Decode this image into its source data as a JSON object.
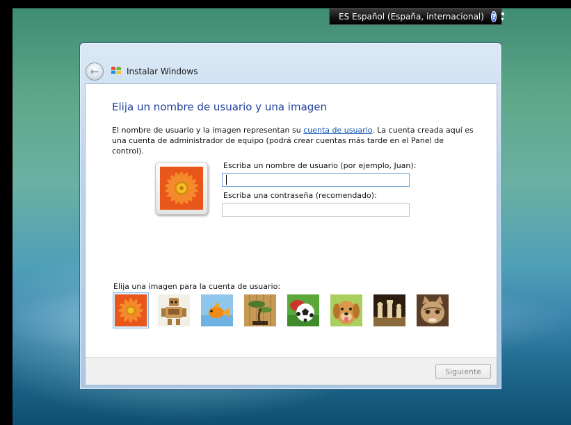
{
  "language_bar": {
    "text": "ES Español (España, internacional)",
    "help_icon": "help-icon",
    "help_label": "?"
  },
  "window": {
    "title": "Instalar Windows",
    "back_icon": "back-arrow-icon",
    "back_label": "←"
  },
  "page": {
    "heading": "Elija un nombre de usuario y una imagen",
    "desc_part1": "El nombre de usuario y la imagen representan su ",
    "desc_link": "cuenta de usuario",
    "desc_part2": ". La cuenta creada aquí es una cuenta de administrador de equipo (podrá crear cuentas más tarde en el Panel de control).",
    "username_label": "Escriba un nombre de usuario (por ejemplo, Juan):",
    "username_value": "",
    "password_label": "Escriba una contraseña (recomendado):",
    "password_value": "",
    "picture_label": "Elija una imagen para la cuenta de usuario:",
    "pictures": [
      {
        "name": "flower-picture",
        "selected": true
      },
      {
        "name": "robot-picture",
        "selected": false
      },
      {
        "name": "goldfish-picture",
        "selected": false
      },
      {
        "name": "bonsai-picture",
        "selected": false
      },
      {
        "name": "soccer-ball-picture",
        "selected": false
      },
      {
        "name": "dog-picture",
        "selected": false
      },
      {
        "name": "chess-picture",
        "selected": false
      },
      {
        "name": "kitten-picture",
        "selected": false
      }
    ]
  },
  "footer": {
    "next_label": "Siguiente",
    "next_enabled": false
  },
  "colors": {
    "heading": "#1e3d9a",
    "link": "#0b4fb5",
    "window_frame": "#b9d3ec"
  }
}
